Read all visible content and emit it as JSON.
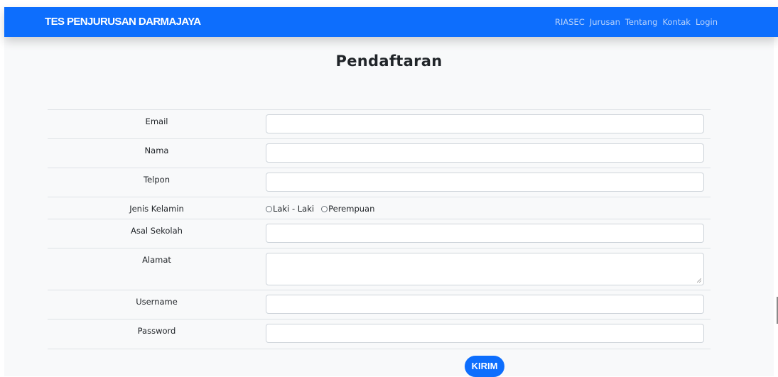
{
  "navbar": {
    "brand": "TES PENJURUSAN DARMAJAYA",
    "links": [
      "RIASEC",
      "Jurusan",
      "Tentang",
      "Kontak",
      "Login"
    ]
  },
  "page": {
    "title": "Pendaftaran"
  },
  "form": {
    "fields": {
      "email": {
        "label": "Email",
        "value": ""
      },
      "nama": {
        "label": "Nama",
        "value": ""
      },
      "telpon": {
        "label": "Telpon",
        "value": ""
      },
      "jenis_kelamin": {
        "label": "Jenis Kelamin",
        "options": [
          "Laki - Laki",
          "Perempuan"
        ]
      },
      "asal_sekolah": {
        "label": "Asal Sekolah",
        "value": ""
      },
      "alamat": {
        "label": "Alamat",
        "value": ""
      },
      "username": {
        "label": "Username",
        "value": ""
      },
      "password": {
        "label": "Password",
        "value": ""
      }
    },
    "submit_label": "KIRIM"
  },
  "colors": {
    "primary": "#0d6efd",
    "page_background": "#f8f9fa"
  }
}
